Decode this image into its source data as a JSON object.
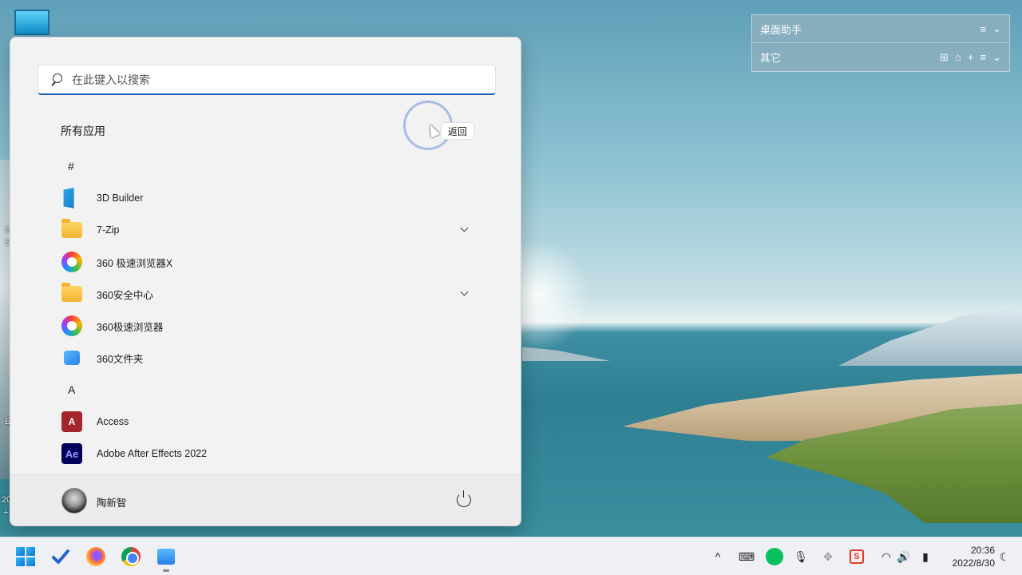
{
  "desktop": {
    "left_edge_texts": [
      "S",
      "S",
      "E",
      "20",
      "+"
    ]
  },
  "widget": {
    "rows": [
      {
        "title": "桌面助手",
        "controls": [
          "≡",
          "⌄"
        ]
      },
      {
        "title": "其它",
        "controls": [
          "⊞",
          "⌂",
          "+",
          "≡",
          "⌄"
        ]
      }
    ]
  },
  "start_menu": {
    "search": {
      "placeholder": "在此键入以搜索"
    },
    "all_apps_title": "所有应用",
    "back_label": "返回",
    "groups": [
      {
        "letter": "#",
        "apps": [
          {
            "label": "3D Builder",
            "icon": "3d-builder-icon",
            "expandable": false
          },
          {
            "label": "7-Zip",
            "icon": "folder-icon",
            "expandable": true
          },
          {
            "label": "360 极速浏览器X",
            "icon": "360-browser-icon",
            "expandable": false
          },
          {
            "label": "360安全中心",
            "icon": "folder-icon",
            "expandable": true
          },
          {
            "label": "360极速浏览器",
            "icon": "360-browser-icon",
            "expandable": false
          },
          {
            "label": "360文件夹",
            "icon": "360-folder-icon",
            "expandable": false
          }
        ]
      },
      {
        "letter": "A",
        "apps": [
          {
            "label": "Access",
            "icon": "access-icon",
            "icon_text": "A",
            "expandable": false
          },
          {
            "label": "Adobe After Effects 2022",
            "icon": "after-effects-icon",
            "icon_text": "Ae",
            "expandable": false
          }
        ]
      }
    ],
    "user": {
      "name": "陶新智"
    }
  },
  "taskbar": {
    "pinned": [
      "start-icon",
      "todo-icon",
      "firefox-icon",
      "chrome-icon",
      "file-explorer-icon"
    ],
    "tray": {
      "chevron": "^",
      "keyboard": "⌨",
      "mic": "🎙",
      "wifi": "◠",
      "volume": "🔊",
      "battery": "▮",
      "sogou": "S",
      "moon": "☾"
    },
    "clock": {
      "time": "20:36",
      "date": "2022/8/30"
    }
  }
}
